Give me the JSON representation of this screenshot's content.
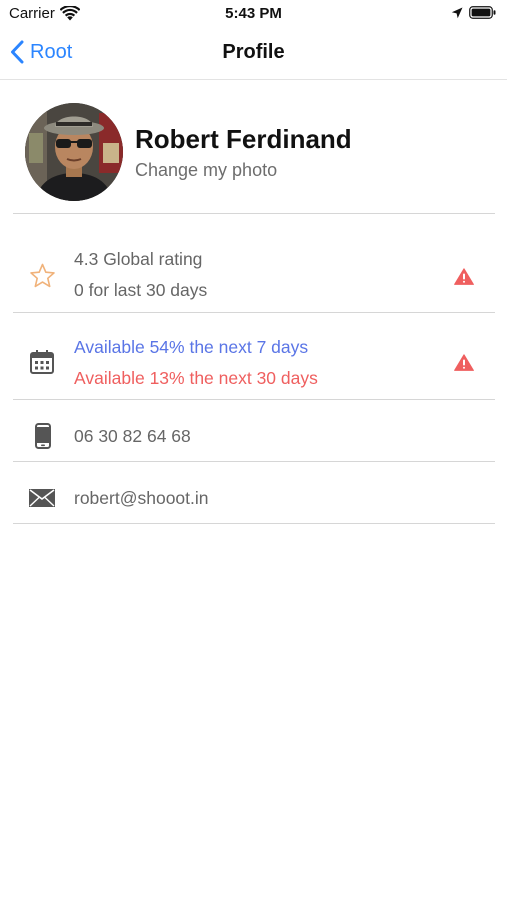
{
  "status_bar": {
    "carrier": "Carrier",
    "time": "5:43 PM"
  },
  "nav": {
    "back_label": "Root",
    "title": "Profile"
  },
  "profile": {
    "name": "Robert Ferdinand",
    "change_photo": "Change my photo"
  },
  "rows": {
    "rating": {
      "icon": "star-icon",
      "line1": "4.3 Global rating",
      "line2": "0 for last 30 days",
      "warning_icon": "warning-icon"
    },
    "availability": {
      "icon": "calendar-icon",
      "line1": "Available 54% the next 7 days",
      "line2": "Available 13% the next 30 days",
      "warning_icon": "warning-icon"
    },
    "phone": {
      "icon": "phone-icon",
      "value": "06 30 82 64 68"
    },
    "email": {
      "icon": "mail-icon",
      "value": "robert@shooot.in"
    }
  },
  "colors": {
    "accent_blue": "#2b85ff",
    "availability_ok": "#5a75e6",
    "availability_low": "#ef5f5f",
    "warning": "#ef5f5f",
    "star": "#f0b27a"
  }
}
